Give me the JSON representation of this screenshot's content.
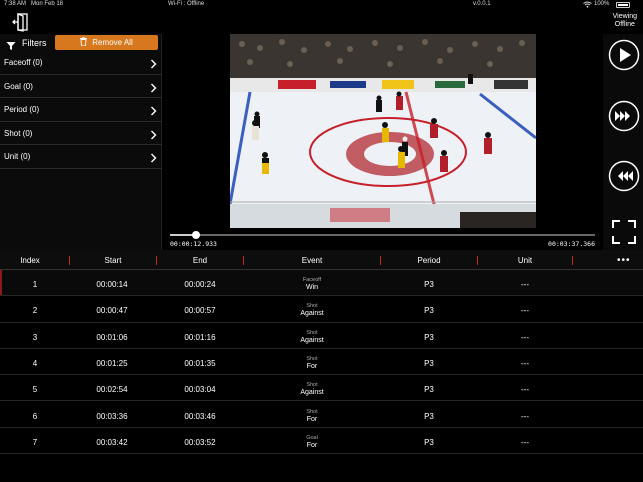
{
  "status_bar": {
    "time": "7:38 AM",
    "date": "Mon Feb 18",
    "network": "Wi-Fi : Offline",
    "version": "v.0.0.1",
    "battery": "100%"
  },
  "header": {
    "viewing_line1": "Viewing",
    "viewing_line2": "Offline"
  },
  "filters": {
    "label": "Filters",
    "remove_all": "Remove All",
    "items": [
      {
        "label": "Faceoff (0)"
      },
      {
        "label": "Goal (0)"
      },
      {
        "label": "Period (0)"
      },
      {
        "label": "Shot (0)"
      },
      {
        "label": "Unit (0)"
      }
    ]
  },
  "player": {
    "current_time": "00:00:12.933",
    "total_time": "00:03:37.366",
    "progress": 0.06
  },
  "table": {
    "columns": [
      "Index",
      "Start",
      "End",
      "Event",
      "Period",
      "Unit"
    ],
    "rows": [
      {
        "index": "1",
        "start": "00:00:14",
        "end": "00:00:24",
        "event_type": "Faceoff",
        "event_result": "Win",
        "period": "P3",
        "unit": "---"
      },
      {
        "index": "2",
        "start": "00:00:47",
        "end": "00:00:57",
        "event_type": "Shot",
        "event_result": "Against",
        "period": "P3",
        "unit": "---"
      },
      {
        "index": "3",
        "start": "00:01:06",
        "end": "00:01:16",
        "event_type": "Shot",
        "event_result": "Against",
        "period": "P3",
        "unit": "---"
      },
      {
        "index": "4",
        "start": "00:01:25",
        "end": "00:01:35",
        "event_type": "Shot",
        "event_result": "For",
        "period": "P3",
        "unit": "---"
      },
      {
        "index": "5",
        "start": "00:02:54",
        "end": "00:03:04",
        "event_type": "Shot",
        "event_result": "Against",
        "period": "P3",
        "unit": "---"
      },
      {
        "index": "6",
        "start": "00:03:36",
        "end": "00:03:46",
        "event_type": "Shot",
        "event_result": "For",
        "period": "P3",
        "unit": "---"
      },
      {
        "index": "7",
        "start": "00:03:42",
        "end": "00:03:52",
        "event_type": "Goal",
        "event_result": "For",
        "period": "P3",
        "unit": "---"
      }
    ]
  },
  "colors": {
    "accent_orange": "#d8781e",
    "header_separator": "#c62828",
    "selected_marker": "#8b1a1a"
  },
  "icons": [
    "exit-icon",
    "filter-icon",
    "trash-icon",
    "chevron-right-icon",
    "play-icon",
    "fast-forward-icon",
    "rewind-icon",
    "fullscreen-icon",
    "more-icon",
    "wifi-icon",
    "battery-icon"
  ]
}
